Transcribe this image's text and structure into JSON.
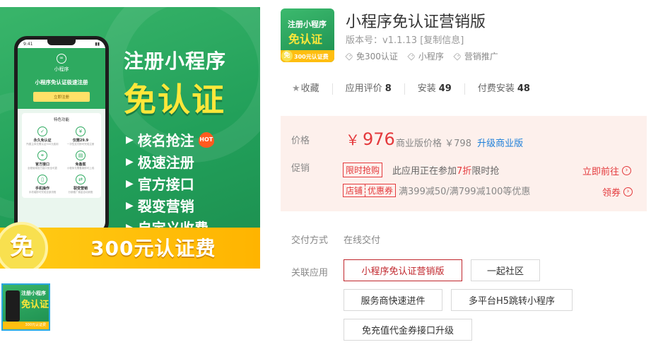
{
  "hero": {
    "headline1": "注册小程序",
    "headline2": "免认证",
    "features": [
      "核名抢注",
      "极速注册",
      "官方接口",
      "裂变营销",
      "自定义收费"
    ],
    "hot_label": "HOT",
    "badge": "免",
    "amount": "300元认证费",
    "phone": {
      "time": "9:41",
      "app_name": "小程序",
      "title": "小程序免认证极速注册",
      "button": "立即注册",
      "section": "特色功能",
      "features": [
        {
          "name": "永久免认证",
          "desc": "所属主体无需认证300元费用"
        },
        {
          "name": "仅需29.9",
          "desc": "一次性支付即可完成注册"
        },
        {
          "name": "官方接口",
          "desc": "全程使用官方接口安全可靠"
        },
        {
          "name": "免备案",
          "desc": "小程序无需备案即可上线"
        },
        {
          "name": "手机操作",
          "desc": "手机端即可完成全部流程"
        },
        {
          "name": "裂变营销",
          "desc": "分销推广佣金自动到账"
        }
      ]
    }
  },
  "thumbnail": {
    "line1": "注册小程序",
    "line2": "免认证",
    "strip": "300元认证费"
  },
  "app_icon": {
    "line1": "注册小程序",
    "line2": "免认证",
    "badge": "免",
    "amount": "300元认证费"
  },
  "app": {
    "title": "小程序免认证营销版",
    "version_label": "版本号：",
    "version": "v1.1.13",
    "copy_label": "[复制信息]",
    "tags": [
      "免300认证",
      "小程序",
      "营销推广"
    ]
  },
  "stats": {
    "favorite": "收藏",
    "rating_label": "应用评价",
    "rating_count": "8",
    "install_label": "安装",
    "install_count": "49",
    "paid_label": "付费安装",
    "paid_count": "48"
  },
  "pricing": {
    "price_label": "价格",
    "currency": "￥",
    "price": "976",
    "biz_label": "商业版价格",
    "biz_price": "￥798",
    "upgrade": "升级商业版",
    "promo_label": "促销",
    "flash_tag": "限时抢购",
    "flash_text_pre": "此应用正在参加",
    "flash_discount": "7折",
    "flash_text_post": "限时抢",
    "go_label": "立即前往",
    "coupon_left": "店铺",
    "coupon_right": "优惠券",
    "coupon_text": "满399减50/满799减100等优惠",
    "coupon_link": "领券"
  },
  "delivery": {
    "label": "交付方式",
    "value": "在线交付"
  },
  "related": {
    "label": "关联应用",
    "items": [
      "小程序免认证营销版",
      "一起社区",
      "服务商快速进件",
      "多平台H5跳转小程序",
      "免充值代金券接口升级"
    ]
  },
  "colors": {
    "accent_red": "#e4393c",
    "brand_green": "#22a05a",
    "link_blue": "#1e7fd9",
    "price_panel_bg": "#fdf0ec"
  }
}
